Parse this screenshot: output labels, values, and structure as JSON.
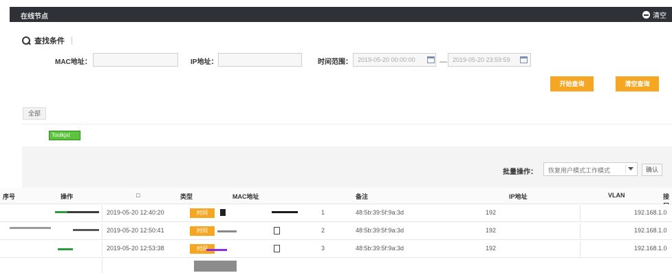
{
  "topbar": {
    "title": "在线节点",
    "clear_label": "清空"
  },
  "search": {
    "title": "查找条件",
    "mac_label": "MAC地址：",
    "mac_value": "",
    "ip_label": "IP地址：",
    "ip_value": "",
    "time_label": "时间范围：",
    "time_start": "2019-05-20 00:00:00",
    "time_end": "2019-05-20 23:59:59",
    "separator": "—",
    "start_button": "开始查询",
    "clear_button": "清空查询"
  },
  "filter": {
    "tab_all": "全部",
    "chip_label": "Toolkjxt"
  },
  "batch": {
    "label": "批量操作：",
    "selected": "恢复用户模式工作模式",
    "confirm": "确认"
  },
  "table": {
    "columns": [
      "序号",
      "操作",
      "□",
      "类型",
      "MAC地址",
      "备注",
      "IP地址",
      "VLAN",
      "接口"
    ],
    "rows": [
      {
        "time": "2019-05-20 12:40:20",
        "type": "时间",
        "no": "1",
        "mac": "48:5b:39:5f:9a:3d",
        "ip": "192",
        "port": "192.168.1.0"
      },
      {
        "time": "2019-05-20 12:50:41",
        "type": "时间",
        "no": "2",
        "mac": "48:5b:39:5f:9a:3d",
        "ip": "192",
        "port": "192.168.1.0"
      },
      {
        "time": "2019-05-20 12:53:38",
        "type": "时间",
        "no": "3",
        "mac": "48:5b:39:5f:9a:3d",
        "ip": "192",
        "port": "192.168.1.0"
      }
    ]
  },
  "colors": {
    "topbar": "#2f3136",
    "accent": "#f5a623",
    "chip": "#5cc43c"
  }
}
